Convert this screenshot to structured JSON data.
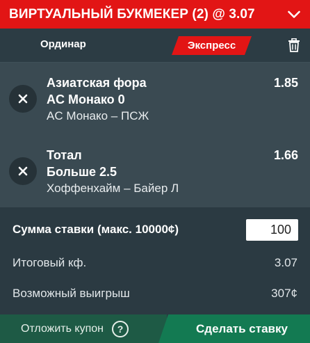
{
  "header": {
    "title": "ВИРТУАЛЬНЫЙ БУКМЕКЕР (2) @ 3.07",
    "chevron_icon": "chevron-down-icon",
    "color": "#e21515"
  },
  "tabs": {
    "single_label": "Ординар",
    "express_label": "Экспресс",
    "active": "express",
    "trash_icon": "trash-icon"
  },
  "bets": [
    {
      "market": "Азиатская фора",
      "outcome": "AC Монако 0",
      "match": "AC Монако – ПСЖ",
      "odds": "1.85",
      "remove_icon": "close-icon"
    },
    {
      "market": "Тотал",
      "outcome": "Больше 2.5",
      "match": "Хоффенхайм – Байер Л",
      "odds": "1.66",
      "remove_icon": "close-icon"
    }
  ],
  "summary": {
    "stake_label": "Сумма ставки (макс. 10000¢)",
    "stake_value": "100",
    "total_odds_label": "Итоговый кф.",
    "total_odds_value": "3.07",
    "possible_win_label": "Возможный выигрыш",
    "possible_win_value": "307¢"
  },
  "footer": {
    "postpone_label": "Отложить купон",
    "help_icon": "question-icon",
    "help_glyph": "?",
    "place_bet_label": "Сделать ставку",
    "postpone_color": "#1e5a45",
    "place_bet_color": "#137a52"
  }
}
